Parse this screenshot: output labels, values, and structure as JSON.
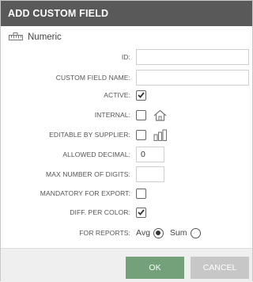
{
  "dialog": {
    "title": "ADD CUSTOM FIELD"
  },
  "field_type": {
    "icon": "ruler-icon",
    "label": "Numeric"
  },
  "form": {
    "id": {
      "label": "ID:",
      "value": ""
    },
    "custom_field_name": {
      "label": "CUSTOM FIELD NAME:",
      "value": ""
    },
    "active": {
      "label": "ACTIVE:",
      "checked": true
    },
    "internal": {
      "label": "INTERNAL:",
      "checked": false,
      "icon": "home-icon"
    },
    "editable_by_supplier": {
      "label": "EDITABLE BY SUPPLIER:",
      "checked": false,
      "icon": "factory-icon"
    },
    "allowed_decimal": {
      "label": "ALLOWED DECIMAL:",
      "value": "0"
    },
    "max_digits": {
      "label": "MAX NUMBER OF DIGITS:",
      "value": ""
    },
    "mandatory_export": {
      "label": "MANDATORY FOR EXPORT:",
      "checked": false
    },
    "diff_per_color": {
      "label": "DIFF. PER COLOR:",
      "checked": true
    },
    "for_reports": {
      "label": "FOR REPORTS:",
      "options": [
        "Avg",
        "Sum"
      ],
      "selected": "Avg"
    }
  },
  "buttons": {
    "ok": "OK",
    "cancel": "CANCEL"
  },
  "colors": {
    "titlebar": "#595959",
    "ok": "#74a07a",
    "cancel": "#c7c7c7"
  }
}
